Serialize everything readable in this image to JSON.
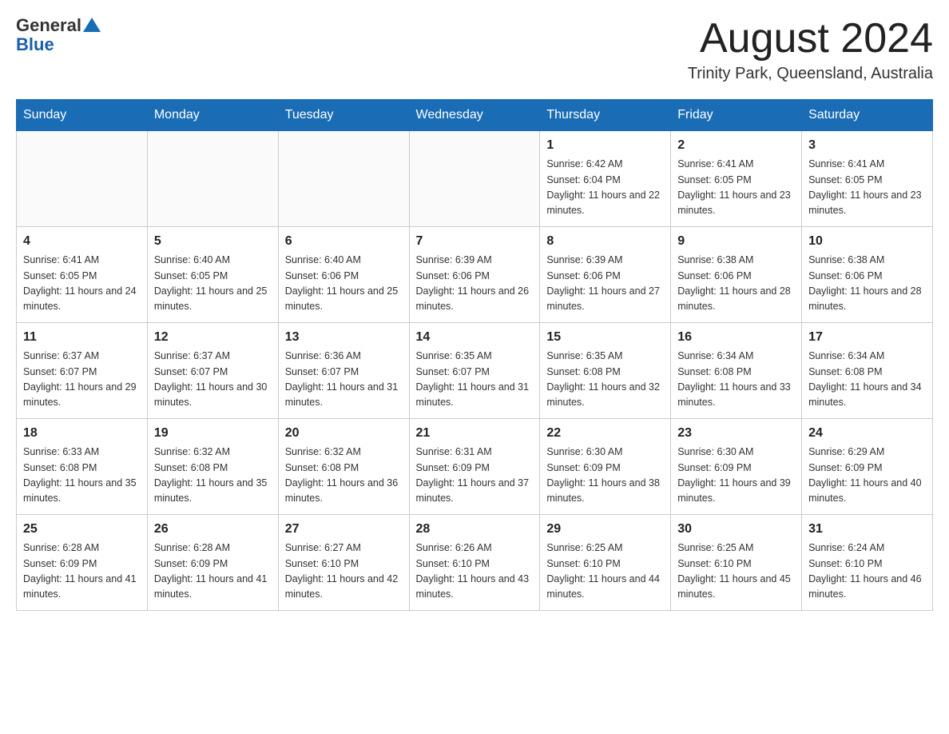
{
  "header": {
    "logo_general": "General",
    "logo_blue": "Blue",
    "title": "August 2024",
    "subtitle": "Trinity Park, Queensland, Australia"
  },
  "days_of_week": [
    "Sunday",
    "Monday",
    "Tuesday",
    "Wednesday",
    "Thursday",
    "Friday",
    "Saturday"
  ],
  "weeks": [
    [
      {
        "day": "",
        "info": ""
      },
      {
        "day": "",
        "info": ""
      },
      {
        "day": "",
        "info": ""
      },
      {
        "day": "",
        "info": ""
      },
      {
        "day": "1",
        "info": "Sunrise: 6:42 AM\nSunset: 6:04 PM\nDaylight: 11 hours and 22 minutes."
      },
      {
        "day": "2",
        "info": "Sunrise: 6:41 AM\nSunset: 6:05 PM\nDaylight: 11 hours and 23 minutes."
      },
      {
        "day": "3",
        "info": "Sunrise: 6:41 AM\nSunset: 6:05 PM\nDaylight: 11 hours and 23 minutes."
      }
    ],
    [
      {
        "day": "4",
        "info": "Sunrise: 6:41 AM\nSunset: 6:05 PM\nDaylight: 11 hours and 24 minutes."
      },
      {
        "day": "5",
        "info": "Sunrise: 6:40 AM\nSunset: 6:05 PM\nDaylight: 11 hours and 25 minutes."
      },
      {
        "day": "6",
        "info": "Sunrise: 6:40 AM\nSunset: 6:06 PM\nDaylight: 11 hours and 25 minutes."
      },
      {
        "day": "7",
        "info": "Sunrise: 6:39 AM\nSunset: 6:06 PM\nDaylight: 11 hours and 26 minutes."
      },
      {
        "day": "8",
        "info": "Sunrise: 6:39 AM\nSunset: 6:06 PM\nDaylight: 11 hours and 27 minutes."
      },
      {
        "day": "9",
        "info": "Sunrise: 6:38 AM\nSunset: 6:06 PM\nDaylight: 11 hours and 28 minutes."
      },
      {
        "day": "10",
        "info": "Sunrise: 6:38 AM\nSunset: 6:06 PM\nDaylight: 11 hours and 28 minutes."
      }
    ],
    [
      {
        "day": "11",
        "info": "Sunrise: 6:37 AM\nSunset: 6:07 PM\nDaylight: 11 hours and 29 minutes."
      },
      {
        "day": "12",
        "info": "Sunrise: 6:37 AM\nSunset: 6:07 PM\nDaylight: 11 hours and 30 minutes."
      },
      {
        "day": "13",
        "info": "Sunrise: 6:36 AM\nSunset: 6:07 PM\nDaylight: 11 hours and 31 minutes."
      },
      {
        "day": "14",
        "info": "Sunrise: 6:35 AM\nSunset: 6:07 PM\nDaylight: 11 hours and 31 minutes."
      },
      {
        "day": "15",
        "info": "Sunrise: 6:35 AM\nSunset: 6:08 PM\nDaylight: 11 hours and 32 minutes."
      },
      {
        "day": "16",
        "info": "Sunrise: 6:34 AM\nSunset: 6:08 PM\nDaylight: 11 hours and 33 minutes."
      },
      {
        "day": "17",
        "info": "Sunrise: 6:34 AM\nSunset: 6:08 PM\nDaylight: 11 hours and 34 minutes."
      }
    ],
    [
      {
        "day": "18",
        "info": "Sunrise: 6:33 AM\nSunset: 6:08 PM\nDaylight: 11 hours and 35 minutes."
      },
      {
        "day": "19",
        "info": "Sunrise: 6:32 AM\nSunset: 6:08 PM\nDaylight: 11 hours and 35 minutes."
      },
      {
        "day": "20",
        "info": "Sunrise: 6:32 AM\nSunset: 6:08 PM\nDaylight: 11 hours and 36 minutes."
      },
      {
        "day": "21",
        "info": "Sunrise: 6:31 AM\nSunset: 6:09 PM\nDaylight: 11 hours and 37 minutes."
      },
      {
        "day": "22",
        "info": "Sunrise: 6:30 AM\nSunset: 6:09 PM\nDaylight: 11 hours and 38 minutes."
      },
      {
        "day": "23",
        "info": "Sunrise: 6:30 AM\nSunset: 6:09 PM\nDaylight: 11 hours and 39 minutes."
      },
      {
        "day": "24",
        "info": "Sunrise: 6:29 AM\nSunset: 6:09 PM\nDaylight: 11 hours and 40 minutes."
      }
    ],
    [
      {
        "day": "25",
        "info": "Sunrise: 6:28 AM\nSunset: 6:09 PM\nDaylight: 11 hours and 41 minutes."
      },
      {
        "day": "26",
        "info": "Sunrise: 6:28 AM\nSunset: 6:09 PM\nDaylight: 11 hours and 41 minutes."
      },
      {
        "day": "27",
        "info": "Sunrise: 6:27 AM\nSunset: 6:10 PM\nDaylight: 11 hours and 42 minutes."
      },
      {
        "day": "28",
        "info": "Sunrise: 6:26 AM\nSunset: 6:10 PM\nDaylight: 11 hours and 43 minutes."
      },
      {
        "day": "29",
        "info": "Sunrise: 6:25 AM\nSunset: 6:10 PM\nDaylight: 11 hours and 44 minutes."
      },
      {
        "day": "30",
        "info": "Sunrise: 6:25 AM\nSunset: 6:10 PM\nDaylight: 11 hours and 45 minutes."
      },
      {
        "day": "31",
        "info": "Sunrise: 6:24 AM\nSunset: 6:10 PM\nDaylight: 11 hours and 46 minutes."
      }
    ]
  ]
}
